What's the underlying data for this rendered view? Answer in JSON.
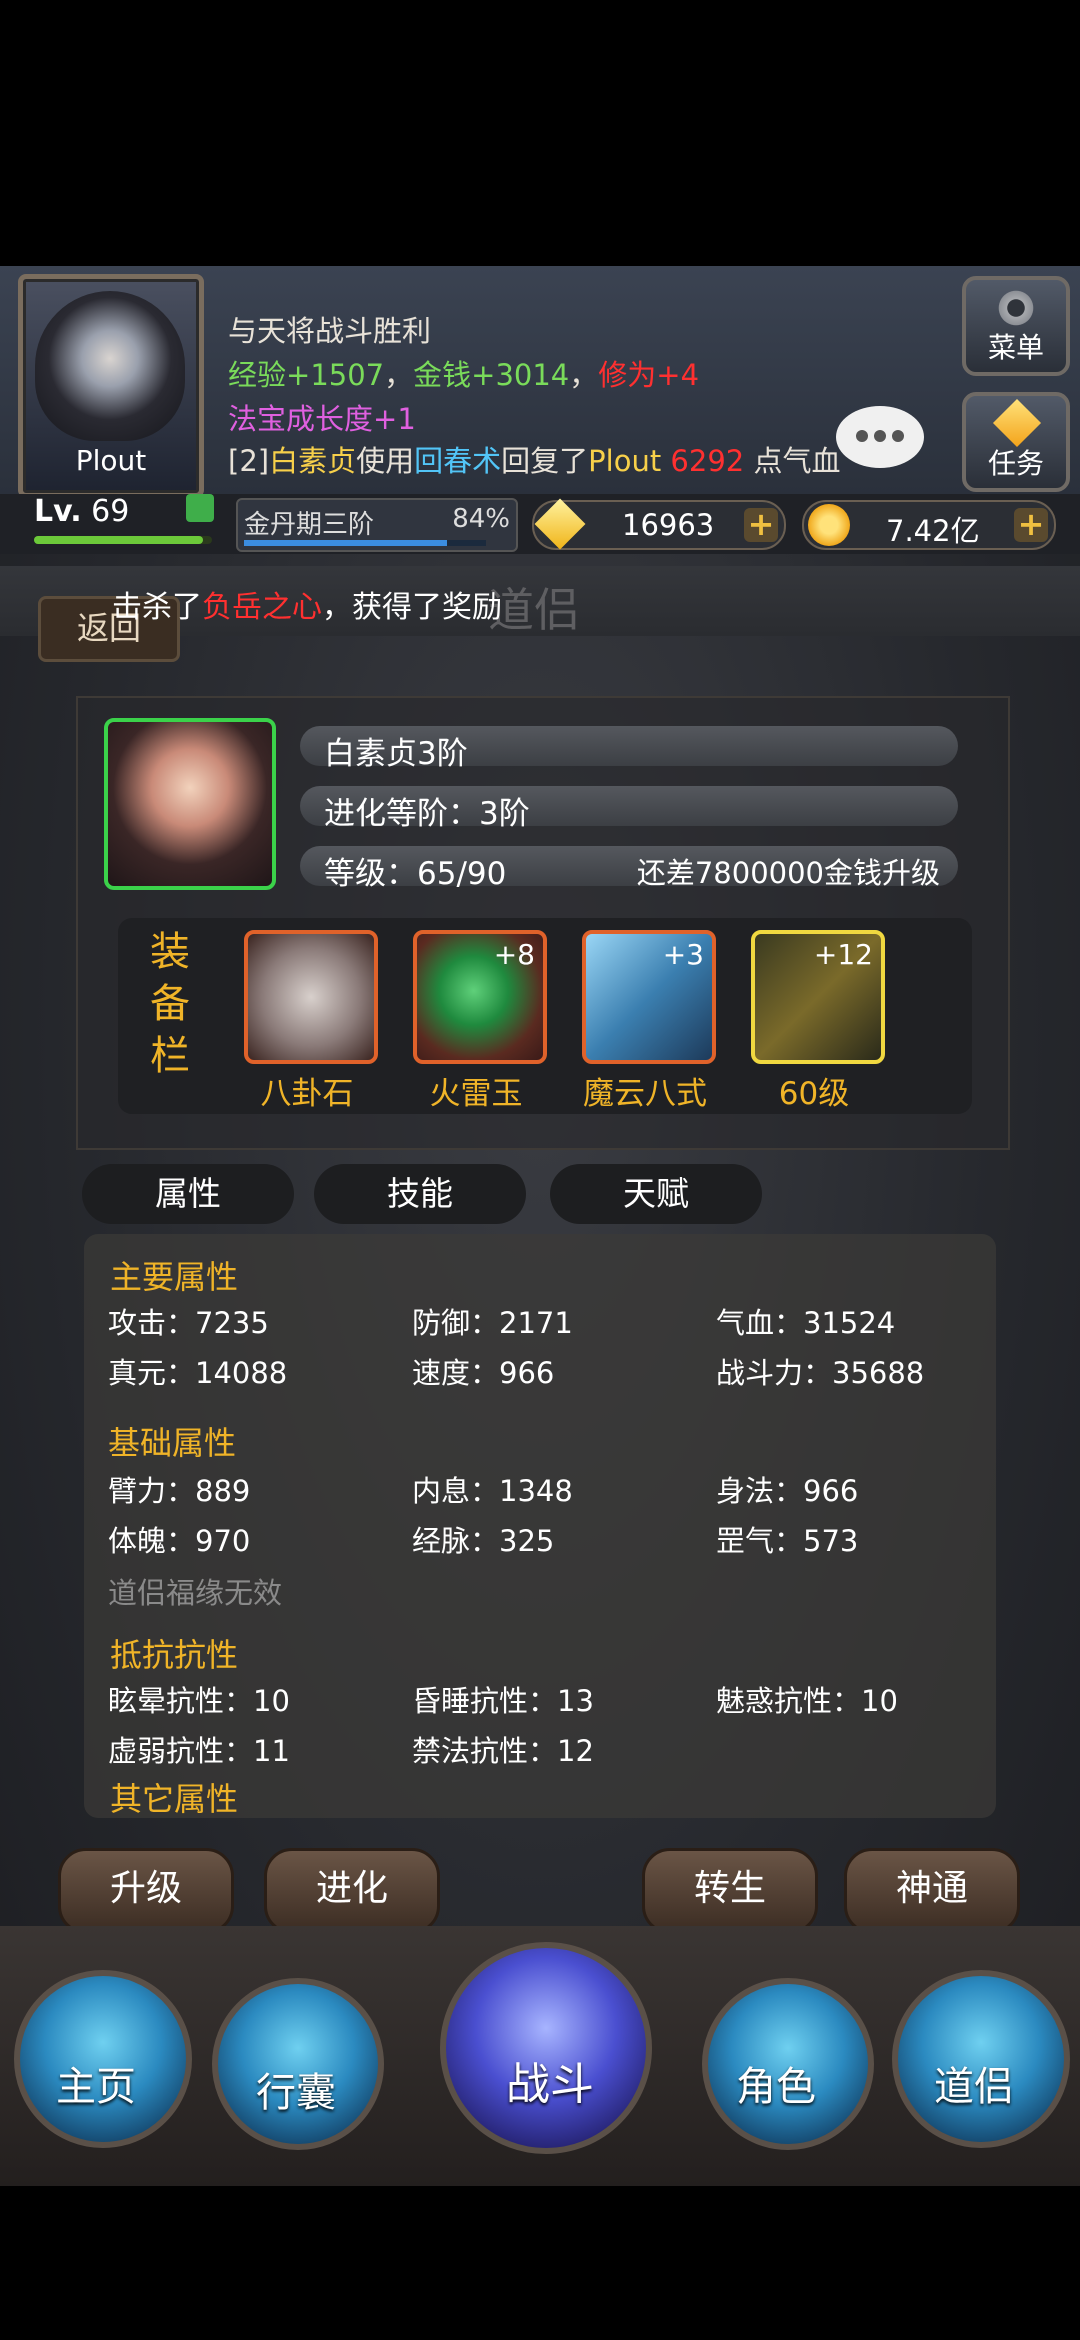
{
  "player": {
    "name": "Plout",
    "level_prefix": "Lv.",
    "level": "69",
    "level_progress": 0.95
  },
  "log": {
    "line1": "与天将战斗胜利",
    "line2": {
      "exp_label": "经验",
      "exp_val": "+1507",
      "sep1": "，",
      "money_label": "金钱",
      "money_val": "+3014",
      "sep2": "，",
      "cult_label": "修为",
      "cult_val": "+4"
    },
    "line3": {
      "label": "法宝成长度",
      "val": "+1"
    },
    "line4": {
      "tag": "[2]",
      "who": "白素贞",
      "verb": "使用",
      "skill": "回春术",
      "action": "回复了",
      "target": "Plout",
      "amount": "6292",
      "suffix": "点气血"
    }
  },
  "buttons": {
    "menu": "菜单",
    "task": "任务"
  },
  "cultivation": {
    "stage": "金丹期三阶",
    "percent": "84%",
    "progress": 0.84
  },
  "currency": {
    "gems": "16963",
    "gold": "7.42亿"
  },
  "page": {
    "back": "返回",
    "title": "道侣",
    "ticker_pre": "击杀了",
    "ticker_boss": "负岳之心",
    "ticker_post": "，获得了奖励"
  },
  "companion": {
    "name": "白素贞3阶",
    "evolution": "进化等阶：3阶",
    "level": "等级：65/90",
    "upgrade_cost": "还差7800000金钱升级",
    "equip_label": [
      "装",
      "备",
      "栏"
    ],
    "equipment": [
      {
        "name": "八卦石",
        "plus": ""
      },
      {
        "name": "火雷玉",
        "plus": "+8"
      },
      {
        "name": "魔云八式",
        "plus": "+3"
      },
      {
        "name": "60级",
        "plus": "+12"
      }
    ]
  },
  "tabs": [
    "属性",
    "技能",
    "天赋"
  ],
  "attributes": {
    "main_title": "主要属性",
    "main": [
      "攻击：7235",
      "防御：2171",
      "气血：31524",
      "真元：14088",
      "速度：966",
      "战斗力：35688"
    ],
    "base_title": "基础属性",
    "base": [
      "臂力：889",
      "内息：1348",
      "身法：966",
      "体魄：970",
      "经脉：325",
      "罡气：573"
    ],
    "fortune_note": "道侣福缘无效",
    "resist_title": "抵抗抗性",
    "resist": [
      "眩晕抗性：10",
      "昏睡抗性：13",
      "魅惑抗性：10",
      "虚弱抗性：11",
      "禁法抗性：12"
    ],
    "other_title": "其它属性"
  },
  "actions": [
    "升级",
    "进化",
    "转生",
    "神通"
  ],
  "nav": [
    "主页",
    "行囊",
    "战斗",
    "角色",
    "道侣"
  ]
}
